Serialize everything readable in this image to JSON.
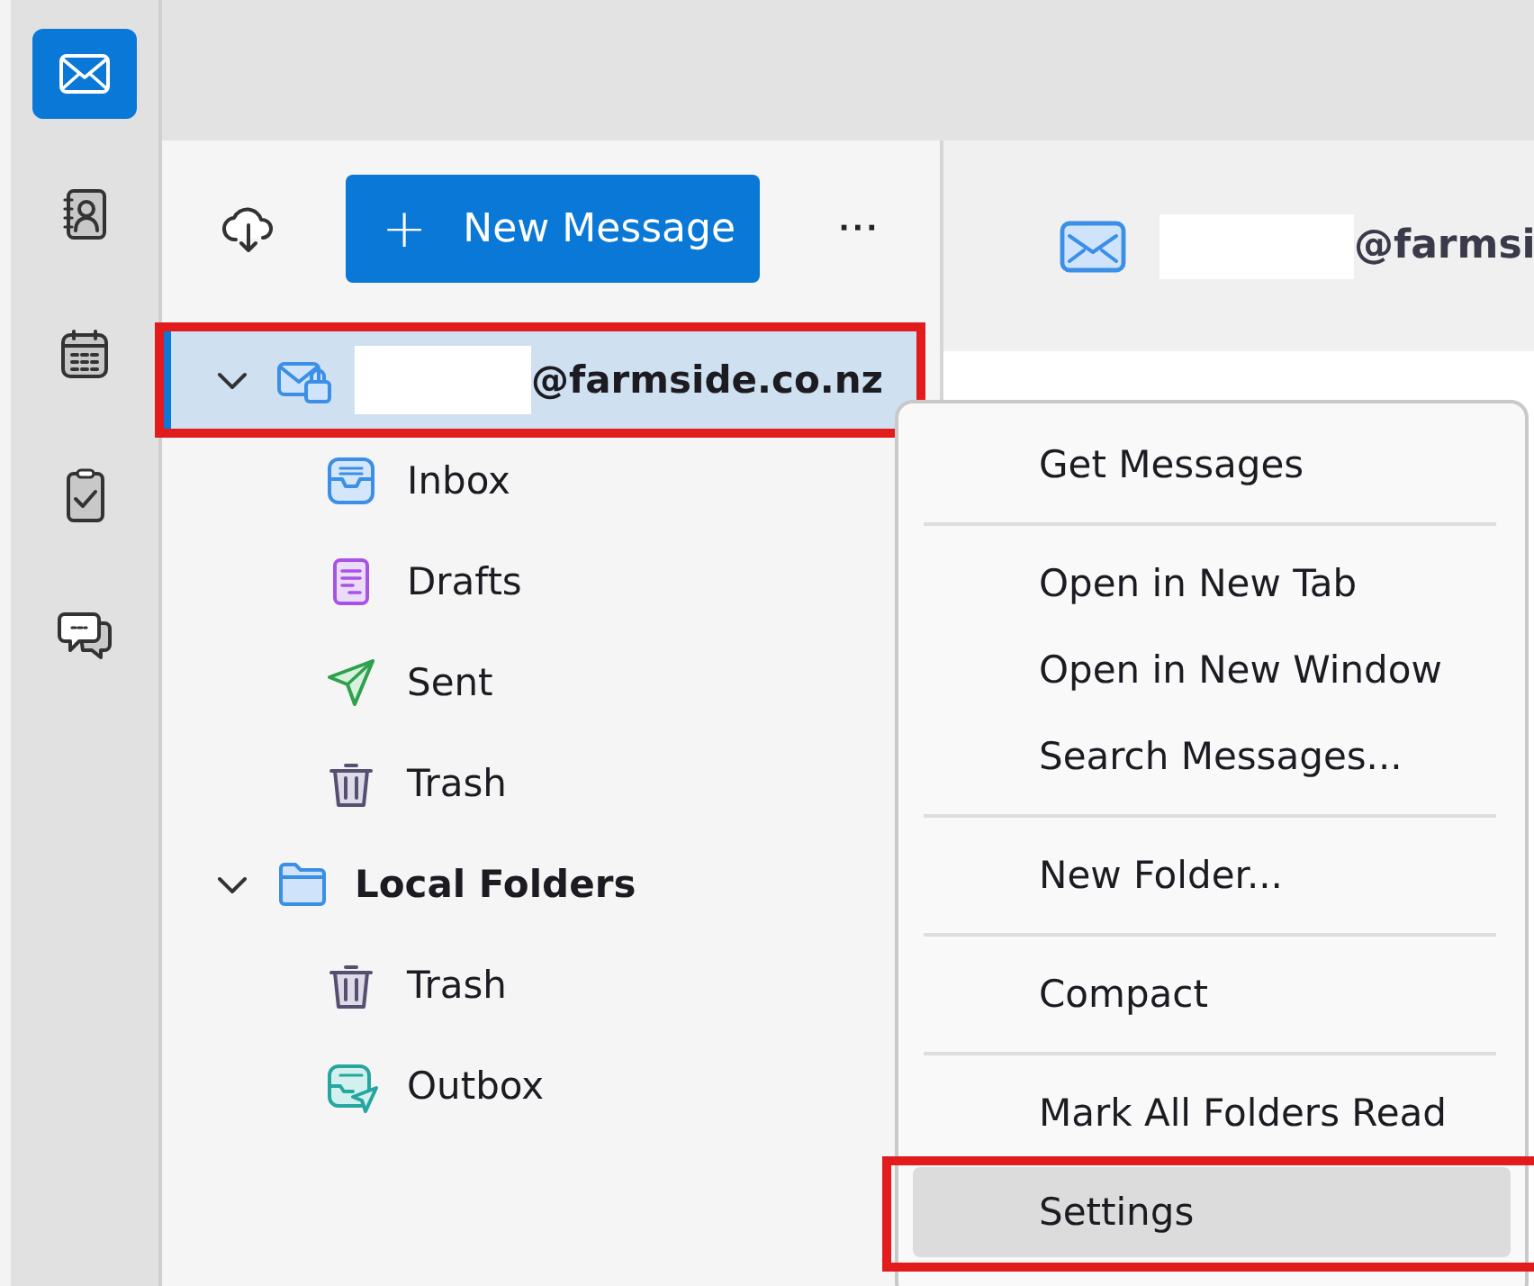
{
  "spaces_toolbar": [
    {
      "kind": "mail",
      "selected": true
    },
    {
      "kind": "contacts",
      "selected": false
    },
    {
      "kind": "calendar",
      "selected": false
    },
    {
      "kind": "tasks",
      "selected": false
    },
    {
      "kind": "chat",
      "selected": false
    }
  ],
  "folder_toolbar": {
    "new_message_button": "New Message",
    "plus": "+",
    "more": "···"
  },
  "account": {
    "email": "@farmside.co.nz",
    "expanded": true,
    "selected": true,
    "highlighted": true,
    "folders": [
      {
        "kind": "inbox",
        "label": "Inbox"
      },
      {
        "kind": "drafts",
        "label": "Drafts"
      },
      {
        "kind": "sent",
        "label": "Sent"
      },
      {
        "kind": "trash",
        "label": "Trash"
      }
    ]
  },
  "local_folders": {
    "label": "Local Folders",
    "expanded": true,
    "folders": [
      {
        "kind": "trash",
        "label": "Trash"
      },
      {
        "kind": "outbox",
        "label": "Outbox"
      }
    ]
  },
  "header": {
    "email": "@farmsi"
  },
  "context_menu": {
    "items": [
      {
        "kind": "item",
        "label": "Get Messages",
        "selected": false,
        "highlighted": false
      },
      {
        "kind": "separator"
      },
      {
        "kind": "item",
        "label": "Open in New Tab",
        "selected": false,
        "highlighted": false
      },
      {
        "kind": "item",
        "label": "Open in New Window",
        "selected": false,
        "highlighted": false
      },
      {
        "kind": "item",
        "label": "Search Messages...",
        "selected": false,
        "highlighted": false
      },
      {
        "kind": "separator"
      },
      {
        "kind": "item",
        "label": "New Folder...",
        "selected": false,
        "highlighted": false
      },
      {
        "kind": "separator"
      },
      {
        "kind": "item",
        "label": "Compact",
        "selected": false,
        "highlighted": false
      },
      {
        "kind": "separator"
      },
      {
        "kind": "item",
        "label": "Mark All Folders Read",
        "selected": false,
        "highlighted": false
      },
      {
        "kind": "item",
        "label": "Settings",
        "selected": true,
        "highlighted": true
      }
    ]
  }
}
